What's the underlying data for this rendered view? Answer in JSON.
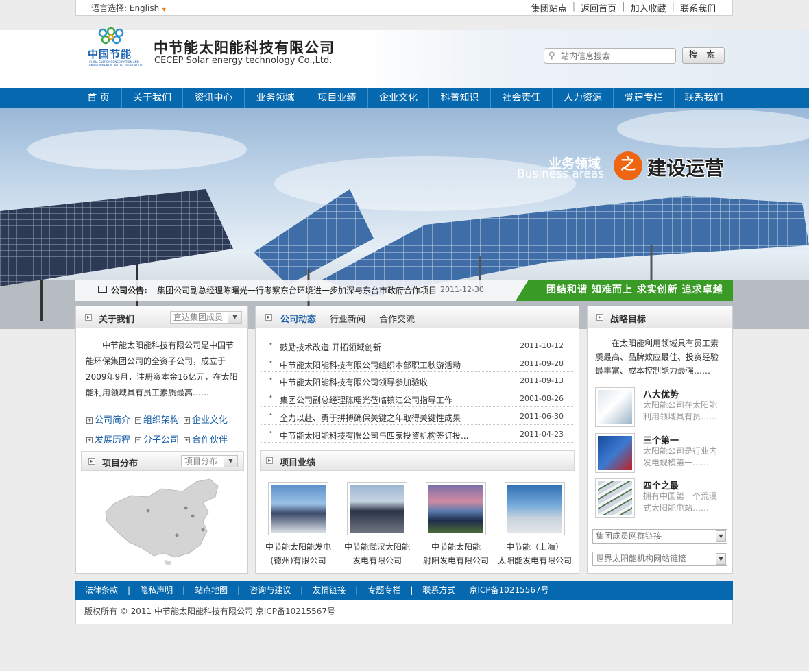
{
  "topbar": {
    "lang_label": "语言选择: English",
    "links": [
      "集团站点",
      "返回首页",
      "加入收藏",
      "联系我们"
    ]
  },
  "header": {
    "logo_cn": "中国节能",
    "logo_en": "CHINA ENERGY CONSERVATION AND ENVIRONMENTAL PROTECTION GROUP",
    "title_cn": "中节能太阳能科技有限公司",
    "title_en": "CECEP Solar energy technology Co.,Ltd.",
    "search_placeholder": "站内信息搜索",
    "search_button": "搜 索"
  },
  "nav": [
    "首 页",
    "关于我们",
    "资讯中心",
    "业务领域",
    "项目业绩",
    "企业文化",
    "科普知识",
    "社会责任",
    "人力资源",
    "党建专栏",
    "联系我们"
  ],
  "banner": {
    "line1": "业务领域",
    "line2": "Business areas",
    "zhi": "之",
    "line3": "建设运营",
    "notice_label": "公司公告:",
    "notice_text": "集团公司副总经理陈曙光一行考察东台环境进一步加深与东台市政府合作项目",
    "notice_date": "2011-12-30",
    "slogan": "团结和谐  知难而上  求实创新  追求卓越"
  },
  "about": {
    "title": "关于我们",
    "dropdown": "直达集团成员",
    "text": "中节能太阳能科技有限公司是中国节能环保集团公司的全资子公司，成立于2009年9月，注册资本金16亿元，在太阳能利用领域具有员工素质最高……",
    "links": [
      "公司简介",
      "组织架构",
      "企业文化",
      "发展历程",
      "分子公司",
      "合作伙伴"
    ],
    "dist_title": "项目分布",
    "dist_dropdown": "项目分布"
  },
  "news": {
    "tabs": [
      "公司动态",
      "行业新闻",
      "合作交流"
    ],
    "items": [
      {
        "title": "鼓励技术改造 开拓领域创新",
        "date": "2011-10-12"
      },
      {
        "title": "中节能太阳能科技有限公司组织本部职工秋游活动",
        "date": "2011-09-28"
      },
      {
        "title": "中节能太阳能科技有限公司领导参加验收",
        "date": "2011-09-13"
      },
      {
        "title": "集团公司副总经理陈曙光莅临镇江公司指导工作",
        "date": "2001-08-26"
      },
      {
        "title": "全力以赴、勇于拼搏确保关键之年取得关键性成果",
        "date": "2011-06-30"
      },
      {
        "title": "中节能太阳能科技有限公司与四家投资机构签订投...",
        "date": "2011-04-23"
      }
    ],
    "projects_title": "项目业绩",
    "projects": [
      {
        "l1": "中节能太阳能发电",
        "l2": "(德州)有限公司"
      },
      {
        "l1": "中节能武汉太阳能",
        "l2": "发电有限公司"
      },
      {
        "l1": "中节能太阳能",
        "l2": "射阳发电有限公司"
      },
      {
        "l1": "中节能（上海）",
        "l2": "太阳能发电有限公司"
      }
    ]
  },
  "strategy": {
    "title": "战略目标",
    "text": "在太阳能利用领域具有员工素质最高、品牌效应最佳、投资经验最丰富、成本控制能力最强……",
    "items": [
      {
        "title": "八大优势",
        "d1": "太阳能公司在太阳能",
        "d2": "利用领域具有员……"
      },
      {
        "title": "三个第一",
        "d1": "太阳能公司是行业内",
        "d2": "发电规模第一……"
      },
      {
        "title": "四个之最",
        "d1": "拥有中国第一个荒漠",
        "d2": "式太阳能电站……"
      }
    ],
    "select1": "集团成员网群链接",
    "select2": "世界太阳能机构网站链接"
  },
  "footer": {
    "links": [
      "法律条款",
      "隐私声明",
      "站点地图",
      "咨询与建议",
      "友情链接",
      "专题专栏",
      "联系方式"
    ],
    "icp": "京ICP备10215567号",
    "copyright": "版权所有 © 2011   中节能太阳能科技有限公司   京ICP备10215567号"
  }
}
